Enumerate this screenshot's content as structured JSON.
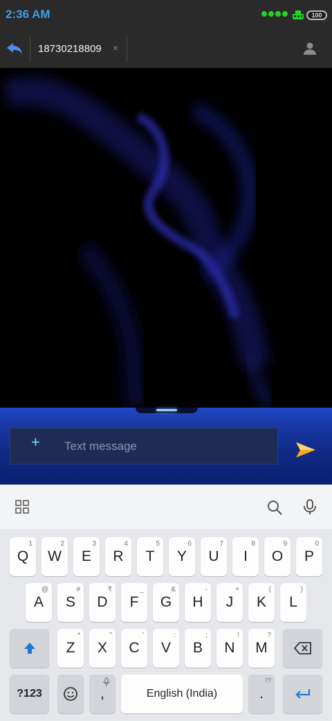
{
  "status_bar": {
    "time": "2:36 AM",
    "battery_level": "100"
  },
  "header": {
    "recipient_number": "18730218809",
    "chip_close": "×"
  },
  "compose": {
    "attach_label": "+",
    "message_placeholder": "Text message"
  },
  "keyboard": {
    "row1": [
      {
        "label": "Q",
        "hint": "1"
      },
      {
        "label": "W",
        "hint": "2"
      },
      {
        "label": "E",
        "hint": "3"
      },
      {
        "label": "R",
        "hint": "4"
      },
      {
        "label": "T",
        "hint": "5"
      },
      {
        "label": "Y",
        "hint": "6"
      },
      {
        "label": "U",
        "hint": "7"
      },
      {
        "label": "I",
        "hint": "8"
      },
      {
        "label": "O",
        "hint": "9"
      },
      {
        "label": "P",
        "hint": "0"
      }
    ],
    "row2": [
      {
        "label": "A",
        "hint": "@"
      },
      {
        "label": "S",
        "hint": "#"
      },
      {
        "label": "D",
        "hint": "₹"
      },
      {
        "label": "F",
        "hint": "_"
      },
      {
        "label": "G",
        "hint": "&"
      },
      {
        "label": "H",
        "hint": "-"
      },
      {
        "label": "J",
        "hint": "+"
      },
      {
        "label": "K",
        "hint": "("
      },
      {
        "label": "L",
        "hint": ")"
      }
    ],
    "row3": [
      {
        "label": "Z",
        "hint": "*"
      },
      {
        "label": "X",
        "hint": "\""
      },
      {
        "label": "C",
        "hint": "'"
      },
      {
        "label": "V",
        "hint": ":"
      },
      {
        "label": "B",
        "hint": ";"
      },
      {
        "label": "N",
        "hint": "!"
      },
      {
        "label": "M",
        "hint": "?"
      }
    ],
    "symbols_label": "?123",
    "comma_label": ",",
    "space_label": "English (India)",
    "period_label": ".",
    "period_hint": "!?"
  }
}
